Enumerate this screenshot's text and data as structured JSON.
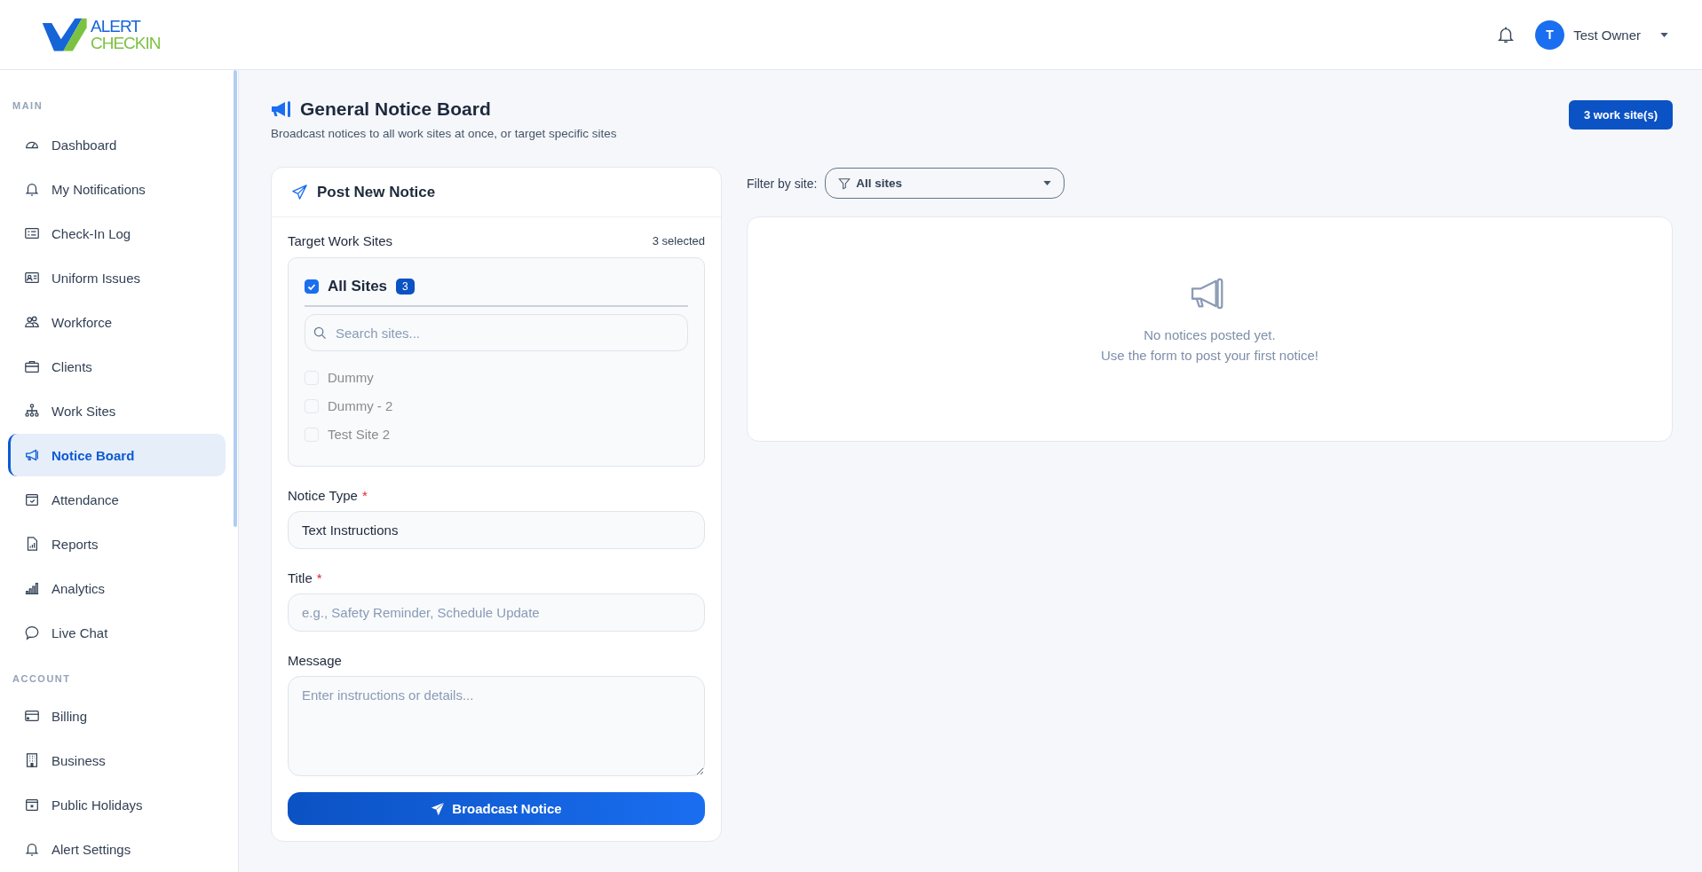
{
  "header": {
    "logo": {
      "line_1": "ALERT",
      "line_2": "CHECKIN"
    },
    "user": {
      "initial": "T",
      "name": "Test Owner"
    }
  },
  "sidebar": {
    "sections": [
      {
        "label": "MAIN",
        "items": [
          {
            "label": "Dashboard",
            "selected": false
          },
          {
            "label": "My Notifications",
            "selected": false
          },
          {
            "label": "Check-In Log",
            "selected": false
          },
          {
            "label": "Uniform Issues",
            "selected": false
          },
          {
            "label": "Workforce",
            "selected": false
          },
          {
            "label": "Clients",
            "selected": false
          },
          {
            "label": "Work Sites",
            "selected": false
          },
          {
            "label": "Notice Board",
            "selected": true
          },
          {
            "label": "Attendance",
            "selected": false
          },
          {
            "label": "Reports",
            "selected": false
          },
          {
            "label": "Analytics",
            "selected": false
          },
          {
            "label": "Live Chat",
            "selected": false
          }
        ]
      },
      {
        "label": "ACCOUNT",
        "items": [
          {
            "label": "Billing",
            "selected": false
          },
          {
            "label": "Business",
            "selected": false
          },
          {
            "label": "Public Holidays",
            "selected": false
          },
          {
            "label": "Alert Settings",
            "selected": false
          }
        ]
      }
    ]
  },
  "page": {
    "title": "General Notice Board",
    "subtitle": "Broadcast notices to all work sites at once, or target specific sites",
    "site_count_button": "3 work site(s)"
  },
  "form": {
    "title": "Post New Notice",
    "target": {
      "label": "Target Work Sites",
      "count": "3 selected",
      "all": {
        "label": "All Sites",
        "badge": "3",
        "checked": true
      },
      "search_placeholder": "Search sites...",
      "sites": [
        {
          "label": "Dummy",
          "checked": false,
          "disabled": true
        },
        {
          "label": "Dummy - 2",
          "checked": false,
          "disabled": true
        },
        {
          "label": "Test Site 2",
          "checked": false,
          "disabled": true
        }
      ]
    },
    "fields": [
      {
        "kind": "select",
        "label": "Notice Type",
        "required_mark": "*",
        "value": "Text Instructions"
      },
      {
        "kind": "input",
        "label": "Title",
        "required_mark": "*",
        "placeholder": "e.g., Safety Reminder, Schedule Update"
      },
      {
        "kind": "textarea",
        "label": "Message",
        "placeholder": "Enter instructions or details..."
      }
    ],
    "submit": "Broadcast Notice"
  },
  "notices": {
    "filter": {
      "label": "Filter by site:",
      "value": "All sites"
    },
    "empty": {
      "line_1": "No notices posted yet.",
      "line_2": "Use the form to post your first notice!"
    }
  }
}
